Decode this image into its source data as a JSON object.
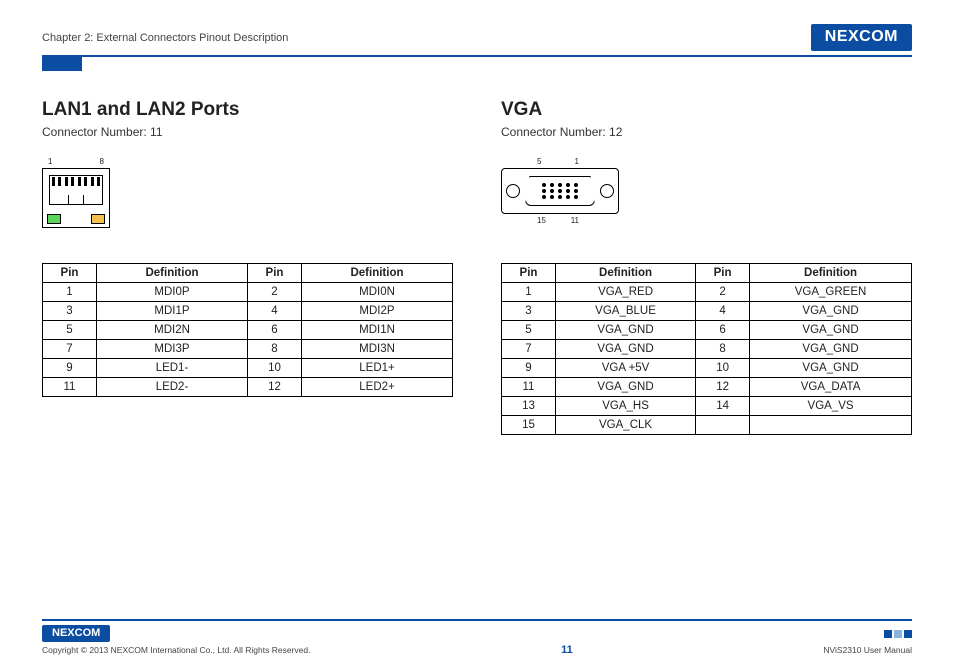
{
  "header": {
    "chapter": "Chapter 2: External Connectors Pinout Description",
    "logo": "NEXCOM"
  },
  "left": {
    "title": "LAN1 and LAN2 Ports",
    "subtitle": "Connector Number: 11",
    "pin_label_left": "1",
    "pin_label_right": "8",
    "table": {
      "headers": [
        "Pin",
        "Definition",
        "Pin",
        "Definition"
      ],
      "rows": [
        [
          "1",
          "MDI0P",
          "2",
          "MDI0N"
        ],
        [
          "3",
          "MDI1P",
          "4",
          "MDI2P"
        ],
        [
          "5",
          "MDI2N",
          "6",
          "MDI1N"
        ],
        [
          "7",
          "MDI3P",
          "8",
          "MDI3N"
        ],
        [
          "9",
          "LED1-",
          "10",
          "LED1+"
        ],
        [
          "11",
          "LED2-",
          "12",
          "LED2+"
        ]
      ]
    }
  },
  "right": {
    "title": "VGA",
    "subtitle": "Connector Number: 12",
    "pin_top_left": "5",
    "pin_top_right": "1",
    "pin_bot_left": "15",
    "pin_bot_right": "11",
    "table": {
      "headers": [
        "Pin",
        "Definition",
        "Pin",
        "Definition"
      ],
      "rows": [
        [
          "1",
          "VGA_RED",
          "2",
          "VGA_GREEN"
        ],
        [
          "3",
          "VGA_BLUE",
          "4",
          "VGA_GND"
        ],
        [
          "5",
          "VGA_GND",
          "6",
          "VGA_GND"
        ],
        [
          "7",
          "VGA_GND",
          "8",
          "VGA_GND"
        ],
        [
          "9",
          "VGA +5V",
          "10",
          "VGA_GND"
        ],
        [
          "11",
          "VGA_GND",
          "12",
          "VGA_DATA"
        ],
        [
          "13",
          "VGA_HS",
          "14",
          "VGA_VS"
        ],
        [
          "15",
          "VGA_CLK",
          "",
          ""
        ]
      ]
    }
  },
  "footer": {
    "logo": "NEXCOM",
    "copyright": "Copyright © 2013 NEXCOM International Co., Ltd. All Rights Reserved.",
    "page": "11",
    "manual": "NViS2310 User Manual"
  }
}
